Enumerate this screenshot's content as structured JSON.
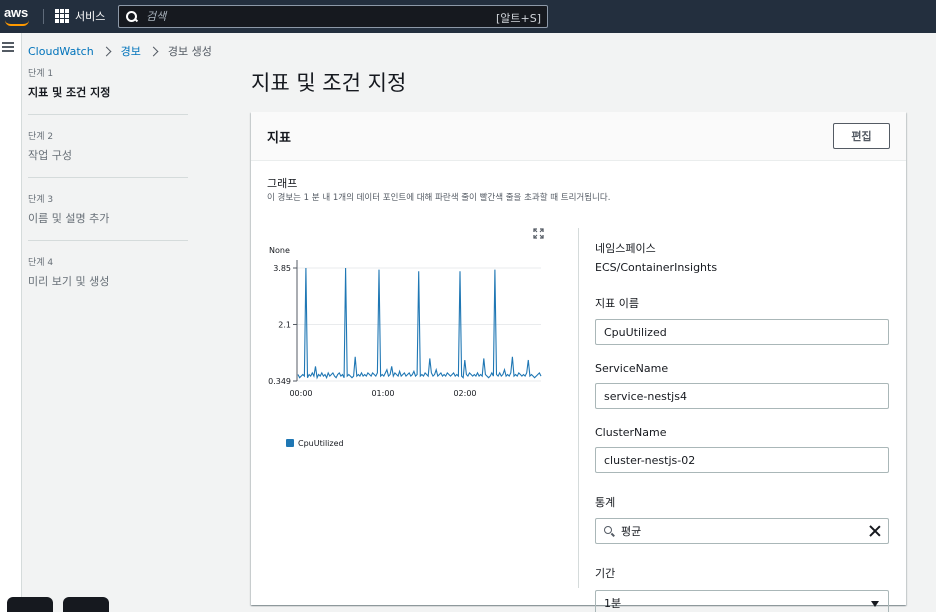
{
  "topnav": {
    "logo_text": "aws",
    "services_label": "서비스",
    "search_placeholder": "검색",
    "search_shortcut": "[알트+S]"
  },
  "breadcrumb": {
    "items": [
      "CloudWatch",
      "경보",
      "경보 생성"
    ]
  },
  "steps": [
    {
      "number": "단계 1",
      "title": "지표 및 조건 지정",
      "active": true
    },
    {
      "number": "단계 2",
      "title": "작업 구성",
      "active": false
    },
    {
      "number": "단계 3",
      "title": "이름 및 설명 추가",
      "active": false
    },
    {
      "number": "단계 4",
      "title": "미리 보기 및 생성",
      "active": false
    }
  ],
  "page_title": "지표 및 조건 지정",
  "panel": {
    "title": "지표",
    "edit_label": "편집",
    "graph_label": "그래프",
    "graph_description": "이 경보는 1 분 내 1개의 데이터 포인트에 대해 파란색 줄이 빨간색 줄을 초과할 때 트리거됩니다."
  },
  "chart_data": {
    "type": "line",
    "unit_label": "None",
    "y_ticks": [
      "3.85",
      "2.1",
      "0.349"
    ],
    "x_ticks": [
      "00:00",
      "01:00",
      "02:00"
    ],
    "ylim": [
      0.349,
      3.85
    ],
    "series": [
      {
        "name": "CpuUtilized",
        "color": "#1f77b4",
        "values": [
          0.55,
          0.45,
          0.5,
          0.55,
          0.5,
          3.85,
          0.45,
          0.55,
          0.5,
          0.6,
          0.5,
          0.8,
          0.45,
          0.55,
          0.5,
          0.6,
          0.5,
          0.55,
          0.45,
          0.6,
          0.5,
          0.55,
          0.6,
          0.5,
          0.45,
          0.55,
          0.6,
          0.5,
          0.55,
          0.45,
          3.85,
          0.5,
          0.55,
          0.5,
          0.45,
          0.5,
          1.1,
          0.5,
          0.55,
          0.5,
          0.6,
          0.5,
          0.55,
          0.5,
          0.6,
          0.55,
          0.5,
          0.6,
          0.55,
          0.5,
          0.6,
          3.8,
          0.5,
          0.55,
          0.5,
          0.6,
          0.7,
          0.5,
          0.55,
          0.8,
          0.5,
          0.6,
          0.55,
          0.5,
          0.65,
          0.5,
          0.55,
          0.6,
          0.5,
          0.55,
          0.6,
          0.5,
          0.55,
          0.65,
          0.5,
          0.55,
          3.75,
          0.5,
          0.55,
          0.5,
          0.6,
          0.55,
          0.5,
          1.05,
          0.6,
          0.5,
          0.55,
          0.7,
          0.5,
          0.55,
          0.6,
          0.5,
          0.55,
          0.5,
          0.6,
          0.55,
          0.5,
          0.55,
          0.6,
          0.5,
          0.55,
          0.5,
          3.75,
          0.5,
          0.45,
          1.0,
          0.55,
          0.5,
          0.6,
          0.55,
          0.5,
          0.55,
          0.5,
          0.6,
          0.5,
          0.55,
          0.5,
          1.05,
          0.55,
          0.5,
          0.45,
          0.5,
          0.6,
          0.5,
          3.8,
          0.55,
          0.5,
          0.6,
          0.5,
          0.55,
          0.7,
          0.5,
          0.55,
          0.5,
          0.6,
          1.1,
          0.5,
          0.55,
          0.5,
          0.6,
          0.55,
          0.5,
          0.55,
          0.5,
          0.6,
          1.0,
          0.5,
          0.55,
          0.5,
          0.45,
          0.5,
          0.55,
          0.6,
          0.5
        ]
      }
    ]
  },
  "form": {
    "namespace_label": "네임스페이스",
    "namespace_value": "ECS/ContainerInsights",
    "metric_name_label": "지표 이름",
    "metric_name_value": "CpuUtilized",
    "service_name_label": "ServiceName",
    "service_name_value": "service-nestjs4",
    "cluster_name_label": "ClusterName",
    "cluster_name_value": "cluster-nestjs-02",
    "statistic_label": "통계",
    "statistic_value": "평균",
    "period_label": "기간",
    "period_value": "1분"
  }
}
